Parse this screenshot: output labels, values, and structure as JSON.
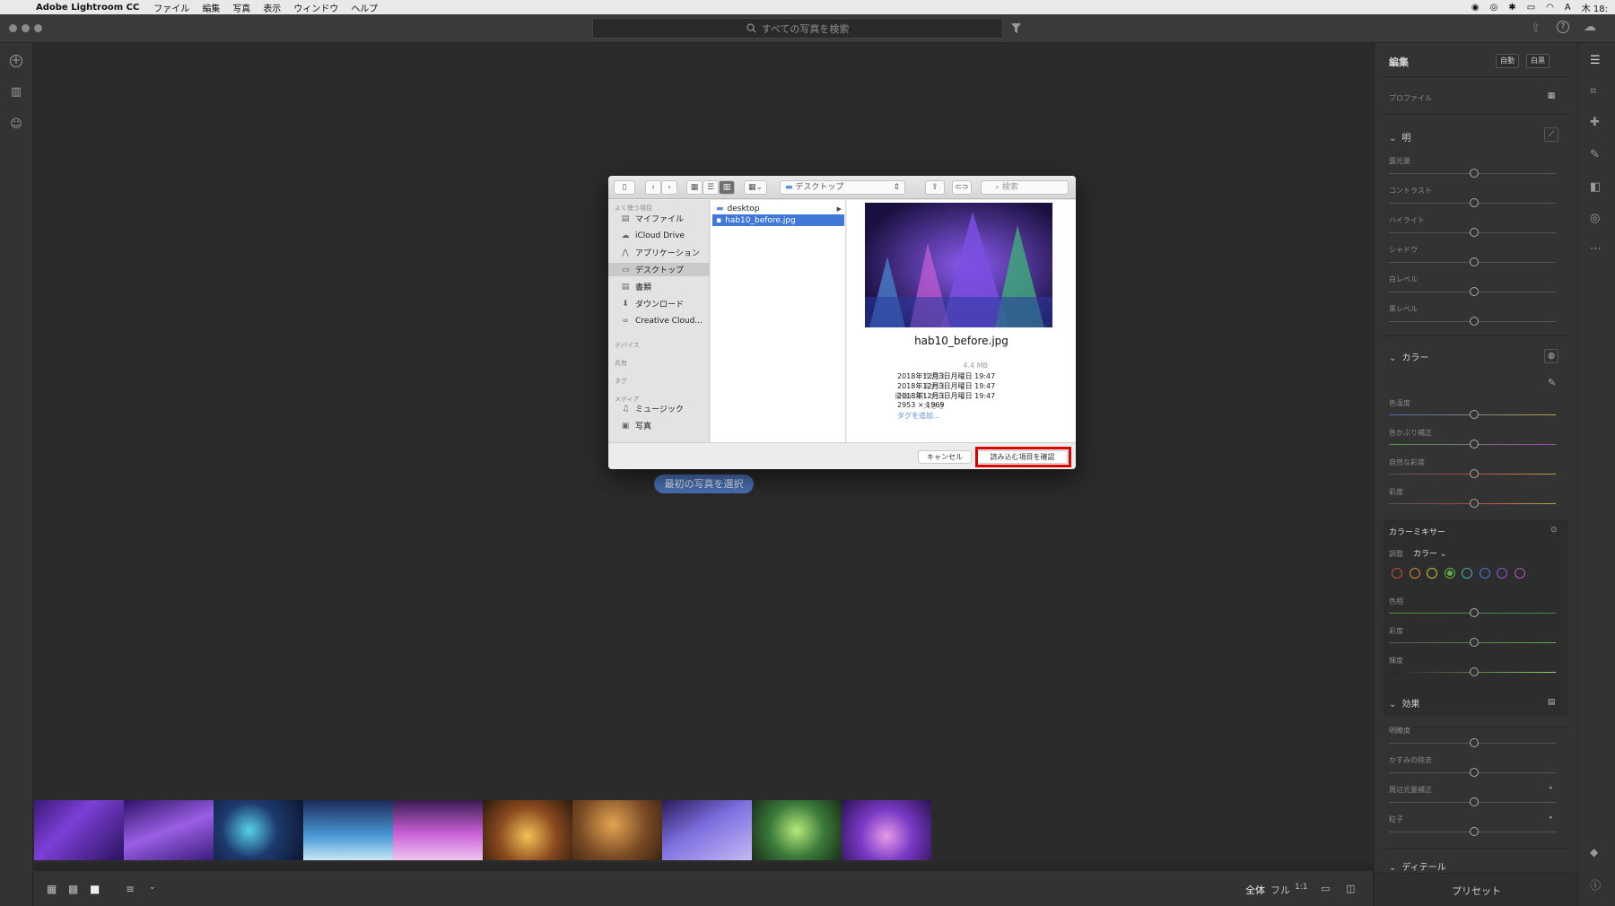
{
  "menubar": {
    "app_name": "Adobe Lightroom CC",
    "items": [
      "ファイル",
      "編集",
      "写真",
      "表示",
      "ウィンドウ",
      "ヘルプ"
    ],
    "clock": "木 18:"
  },
  "titlebar": {
    "search_placeholder": "すべての写真を検索"
  },
  "center": {
    "first_photo_button": "最初の写真を選択"
  },
  "dialog": {
    "location": "デスクトップ",
    "search_placeholder": "検索",
    "sidebar": {
      "favorites_header": "よく使う項目",
      "favorites": [
        {
          "label": "マイファイル",
          "icon": "file-icon"
        },
        {
          "label": "iCloud Drive",
          "icon": "cloud-icon"
        },
        {
          "label": "アプリケーション",
          "icon": "apps-icon"
        },
        {
          "label": "デスクトップ",
          "icon": "desktop-icon",
          "selected": true
        },
        {
          "label": "書類",
          "icon": "document-icon"
        },
        {
          "label": "ダウンロード",
          "icon": "download-icon"
        },
        {
          "label": "Creative Cloud...",
          "icon": "creative-cloud-icon"
        }
      ],
      "devices_header": "デバイス",
      "shared_header": "共有",
      "tags_header": "タグ",
      "media_header": "メディア",
      "media": [
        {
          "label": "ミュージック",
          "icon": "music-icon"
        },
        {
          "label": "写真",
          "icon": "photos-icon"
        }
      ]
    },
    "column_items": [
      {
        "name": "desktop",
        "type": "folder"
      },
      {
        "name": "hab10_before.jpg",
        "type": "image",
        "selected": true
      }
    ],
    "preview": {
      "filename": "hab10_before.jpg",
      "size": "4.4 MB",
      "created_label": "作成日",
      "created": "2018年12月3日月曜日 19:47",
      "modified_label": "変更日",
      "modified": "2018年12月3日月曜日 19:47",
      "opened_label": "最後に開いた日",
      "opened": "2018年12月3日月曜日 19:47",
      "dimensions_label": "大きさ",
      "dimensions": "2953 × 1969",
      "add_tags": "タグを追加..."
    },
    "cancel_label": "キャンセル",
    "confirm_label": "読み込む項目を確認",
    "highlight_color": "#e00000"
  },
  "right_panel": {
    "title": "編集",
    "auto_label": "自動",
    "bw_label": "白黒",
    "profile_label": "プロファイル",
    "light": {
      "header": "明",
      "sliders": [
        "露光量",
        "コントラスト",
        "ハイライト",
        "シャドウ",
        "白レベル",
        "黒レベル"
      ]
    },
    "color": {
      "header": "カラー",
      "sliders": [
        "色温度",
        "色かぶり補正",
        "自然な彩度",
        "彩度"
      ]
    },
    "color_mixer": {
      "header": "カラーミキサー",
      "adjust_label": "調整",
      "adjust_value": "カラー",
      "swatches": [
        "#c94a3a",
        "#d18b2c",
        "#c9c23a",
        "#5fae3f",
        "#3fb0b5",
        "#4d78d6",
        "#8a57d6",
        "#b556b8"
      ],
      "selected_swatch": 3,
      "sliders": [
        "色相",
        "彩度",
        "輝度"
      ]
    },
    "effects": {
      "header": "効果",
      "sliders": [
        "明瞭度",
        "かすみの除去",
        "周辺光量補正",
        "粒子"
      ]
    },
    "detail_header": "ディテール",
    "presets_label": "プリセット"
  },
  "bottombar": {
    "fit_label": "全体",
    "fill_label": "フル",
    "ratio_label": "1:1"
  },
  "accent_color": "#4a72b6"
}
